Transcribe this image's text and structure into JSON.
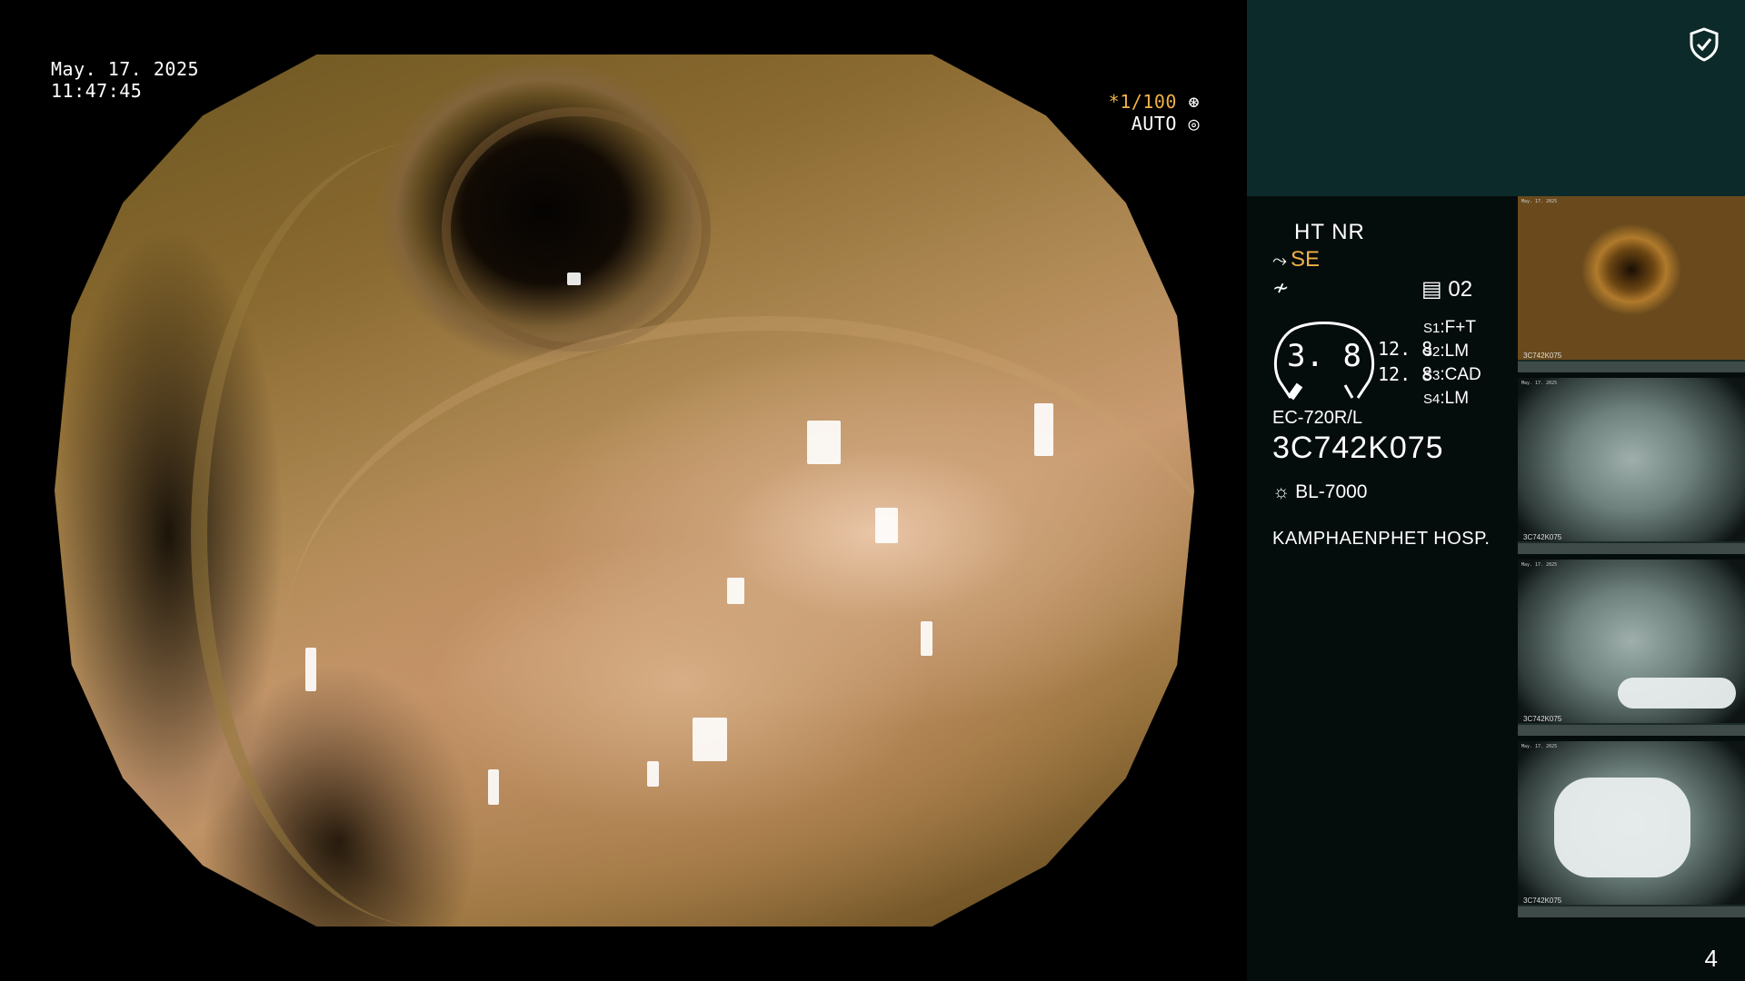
{
  "overlay": {
    "date": "May. 17. 2025",
    "time": "11:47:45",
    "shutter": "*1/100",
    "mode": "AUTO"
  },
  "panel": {
    "ht_nr": "HT NR",
    "se": "SE",
    "preset": "02",
    "gauge_value": "3. 8",
    "gauge_side": [
      "12. 8",
      "12. 8"
    ],
    "switches": [
      {
        "key": "S1",
        "value": "F+T"
      },
      {
        "key": "S2",
        "value": "LM"
      },
      {
        "key": "S3",
        "value": "CAD"
      },
      {
        "key": "S4",
        "value": "LM"
      }
    ],
    "scope_model": "EC-720R/L",
    "scope_serial": "3C742K075",
    "light_source": "BL-7000",
    "hospital": "KAMPHAENPHET HOSP.",
    "page_number": "4"
  },
  "thumbnails": [
    {
      "date": "May. 17. 2025",
      "serial": "3C742K075",
      "scene": "colon"
    },
    {
      "date": "May. 17. 2025",
      "serial": "3C742K075",
      "scene": "room"
    },
    {
      "date": "May. 17. 2025",
      "serial": "3C742K075",
      "scene": "room-glove"
    },
    {
      "date": "May. 17. 2025",
      "serial": "3C742K075",
      "scene": "glove"
    }
  ],
  "colors": {
    "accent": "#f0b048",
    "panel_top": "#0d2a2a",
    "panel_body": "#050c0c"
  },
  "icons": [
    "security-shield-icon",
    "iris-icon",
    "auto-exposure-icon",
    "scope-icon",
    "waveform-icon",
    "preset-icon",
    "light-source-icon"
  ]
}
